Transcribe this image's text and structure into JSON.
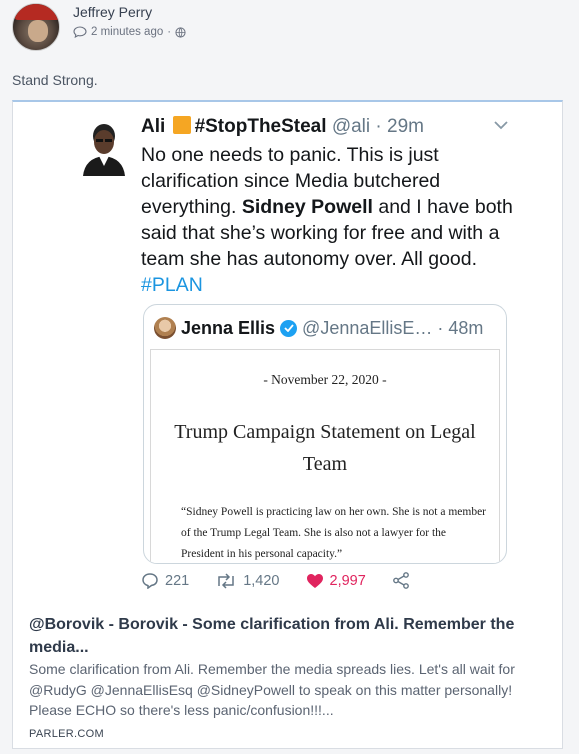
{
  "post": {
    "author": "Jeffrey Perry",
    "timestamp": "2 minutes ago",
    "separator": "·",
    "text": "Stand Strong."
  },
  "tweet": {
    "display_name": "Ali",
    "hashtag_name": "#StopTheSteal",
    "handle": "@ali · 29m",
    "body_1": "No one needs to panic. This is just clarification since Media butchered everything. ",
    "body_hl": "Sidney Powell",
    "body_2": " and I have both said that she’s working for free and with a team she has autonomy over. All good.",
    "body_tag": "#PLAN",
    "replies": "221",
    "retweets": "1,420",
    "likes": "2,997"
  },
  "quote": {
    "display_name": "Jenna Ellis",
    "handle": "@JennaEllisE… · 48m",
    "doc_date": "- November 22, 2020 -",
    "doc_title": "Trump Campaign Statement on Legal Team",
    "doc_quote": "“Sidney Powell is practicing law on her own. She is not a member of the Trump Legal Team. She is also not a lawyer for the President in his personal capacity.”"
  },
  "link_card": {
    "title": "@Borovik - Borovik - Some clarification from Ali. Remember the media...",
    "description": "Some clarification from Ali. Remember the media spreads lies. Let's all wait for @RudyG @JennaEllisEsq @SidneyPowell to speak on this matter personally! Please ECHO so there's less panic/confusion!!!...",
    "domain": "PARLER.COM"
  },
  "icons": {
    "comment": "comment-icon",
    "globe": "globe-icon",
    "chevron": "chevron-down-icon",
    "reply": "reply-icon",
    "retweet": "retweet-icon",
    "like": "heart-icon",
    "share": "share-icon"
  },
  "colors": {
    "link": "#1b95e0",
    "like": "#e0245e",
    "hashtag_badge": "#f5a623"
  }
}
